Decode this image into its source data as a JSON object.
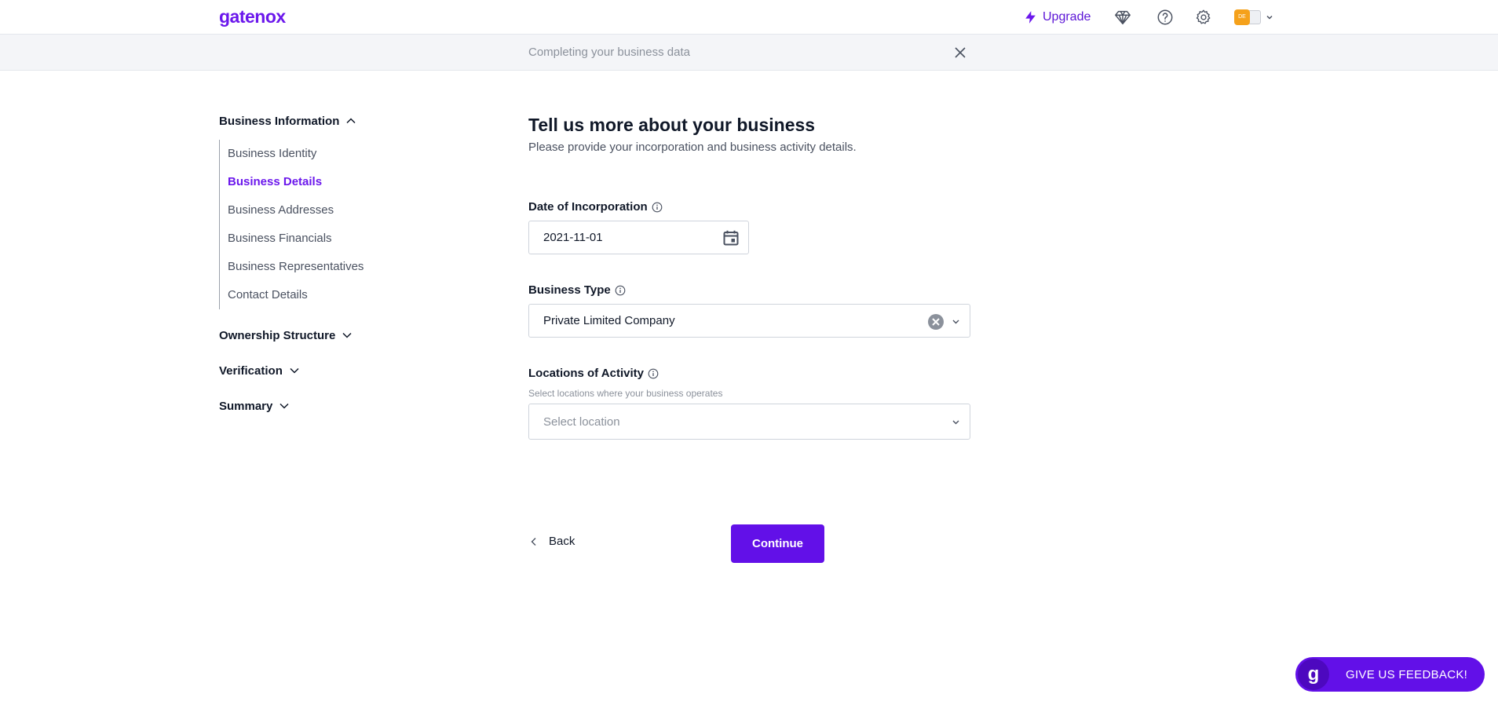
{
  "header": {
    "logo": "gatenox",
    "upgrade_label": "Upgrade",
    "icons": [
      "diamond-icon",
      "help-icon",
      "settings-icon"
    ],
    "avatar_initials": "DE"
  },
  "subheader": {
    "title": "Completing your business data"
  },
  "sidebar": {
    "sections": [
      {
        "label": "Business Information",
        "expanded": true,
        "items": [
          {
            "label": "Business Identity",
            "active": false
          },
          {
            "label": "Business Details",
            "active": true
          },
          {
            "label": "Business Addresses",
            "active": false
          },
          {
            "label": "Business Financials",
            "active": false
          },
          {
            "label": "Business Representatives",
            "active": false
          },
          {
            "label": "Contact Details",
            "active": false
          }
        ]
      },
      {
        "label": "Ownership Structure",
        "expanded": false
      },
      {
        "label": "Verification",
        "expanded": false
      },
      {
        "label": "Summary",
        "expanded": false
      }
    ]
  },
  "main": {
    "title": "Tell us more about your business",
    "subtitle": "Please provide your incorporation and business activity details.",
    "date_of_incorporation": {
      "label": "Date of Incorporation",
      "value": "2021-11-01"
    },
    "business_type": {
      "label": "Business Type",
      "value": "Private Limited Company"
    },
    "locations_of_activity": {
      "label": "Locations of Activity",
      "hint": "Select locations where your business operates",
      "placeholder": "Select location"
    },
    "back_label": "Back",
    "continue_label": "Continue"
  },
  "feedback": {
    "logo_letter": "g",
    "label": "GIVE US FEEDBACK!"
  },
  "colors": {
    "brand": "#6210e8",
    "active_text": "#6b17ec",
    "muted_text": "#8b919b"
  }
}
